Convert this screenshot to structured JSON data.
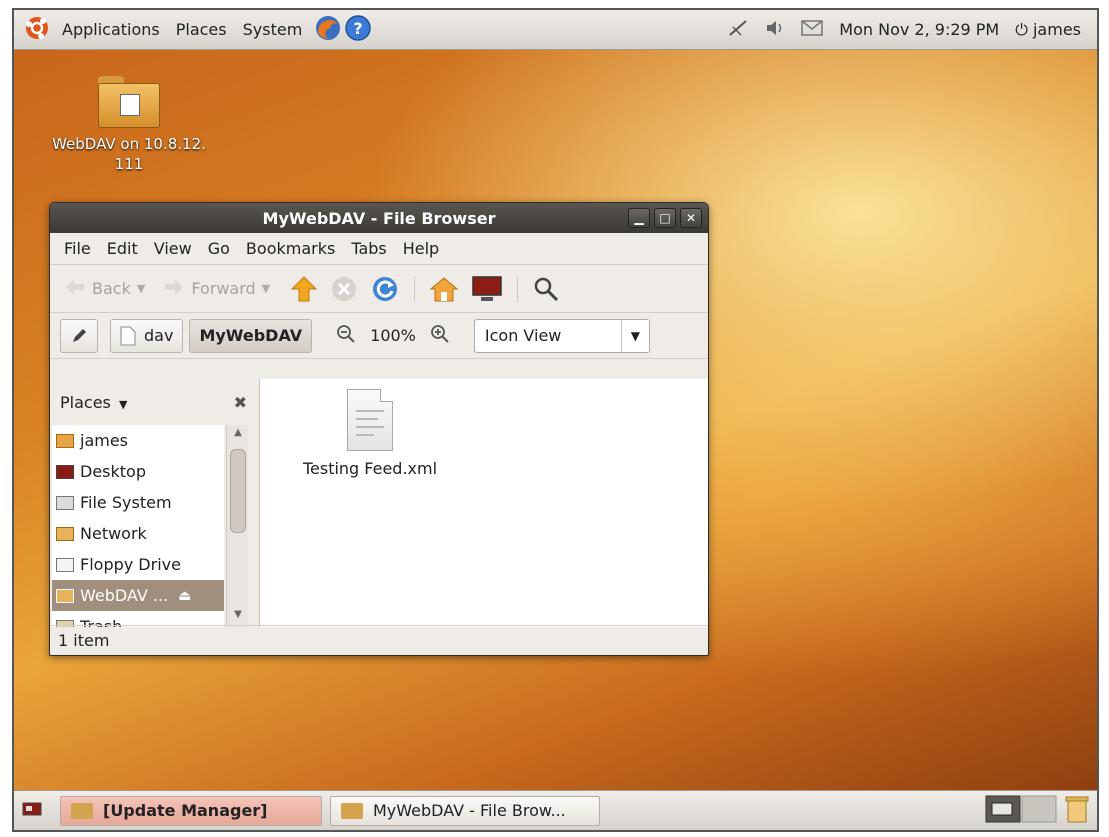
{
  "top_panel": {
    "menus": [
      "Applications",
      "Places",
      "System"
    ],
    "clock": "Mon Nov 2, 9:29 PM",
    "user": "james"
  },
  "desktop": {
    "icon_label_line1": "WebDAV on 10.8.12.",
    "icon_label_line2": "111"
  },
  "window": {
    "title": "MyWebDAV - File Browser",
    "menu": {
      "file": "File",
      "edit": "Edit",
      "view": "View",
      "go": "Go",
      "bookmarks": "Bookmarks",
      "tabs": "Tabs",
      "help": "Help"
    },
    "toolbar": {
      "back": "Back",
      "forward": "Forward"
    },
    "location": {
      "crumbs": [
        "dav",
        "MyWebDAV"
      ],
      "zoom": "100%",
      "view_mode": "Icon View"
    },
    "sidebar": {
      "title": "Places",
      "items": [
        "james",
        "Desktop",
        "File System",
        "Network",
        "Floppy Drive",
        "WebDAV ...",
        "Trash"
      ]
    },
    "files": [
      {
        "name": "Testing Feed.xml"
      }
    ],
    "status": "1 item"
  },
  "taskbar": {
    "tasks": [
      "[Update Manager]",
      "MyWebDAV - File Brow..."
    ]
  }
}
